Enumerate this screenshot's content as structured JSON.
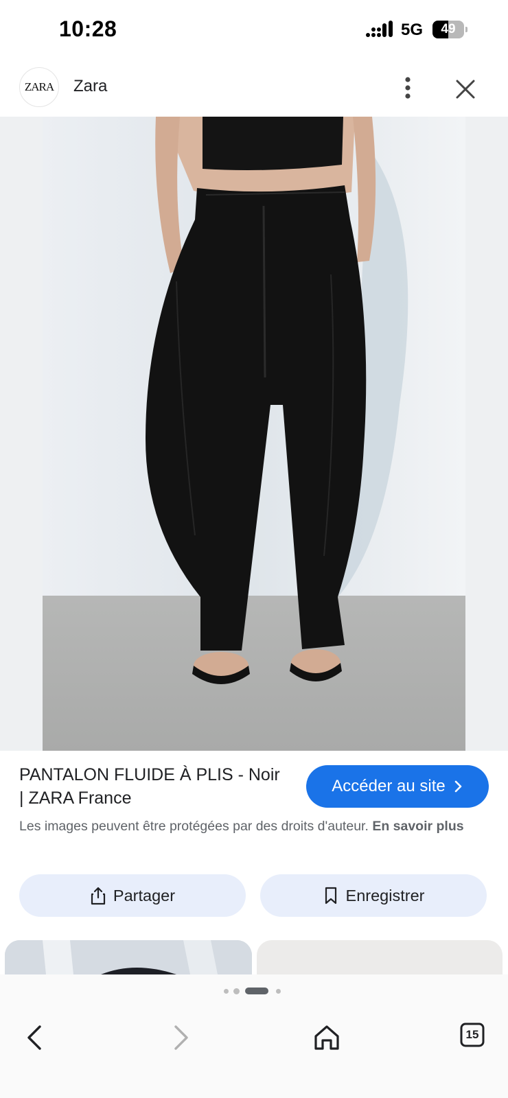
{
  "status_bar": {
    "time": "10:28",
    "network": "5G",
    "battery_level": 49,
    "battery_text": "49"
  },
  "header": {
    "logo_text": "ZARA",
    "source_name": "Zara",
    "more_icon": "more-vertical-icon",
    "close_icon": "close-icon"
  },
  "result": {
    "title": "PANTALON FLUIDE À PLIS - Noir | ZARA France",
    "visit_label": "Accéder au site",
    "copyright_text": "Les images peuvent être protégées par des droits d'auteur.",
    "learn_more": "En savoir plus"
  },
  "actions": {
    "share_label": "Partager",
    "save_label": "Enregistrer"
  },
  "pagination": {
    "active_index": 2,
    "count": 4
  },
  "nav": {
    "tabs_count": "15"
  },
  "colors": {
    "accent": "#1a73e8",
    "action_bg": "#e8eefb"
  }
}
